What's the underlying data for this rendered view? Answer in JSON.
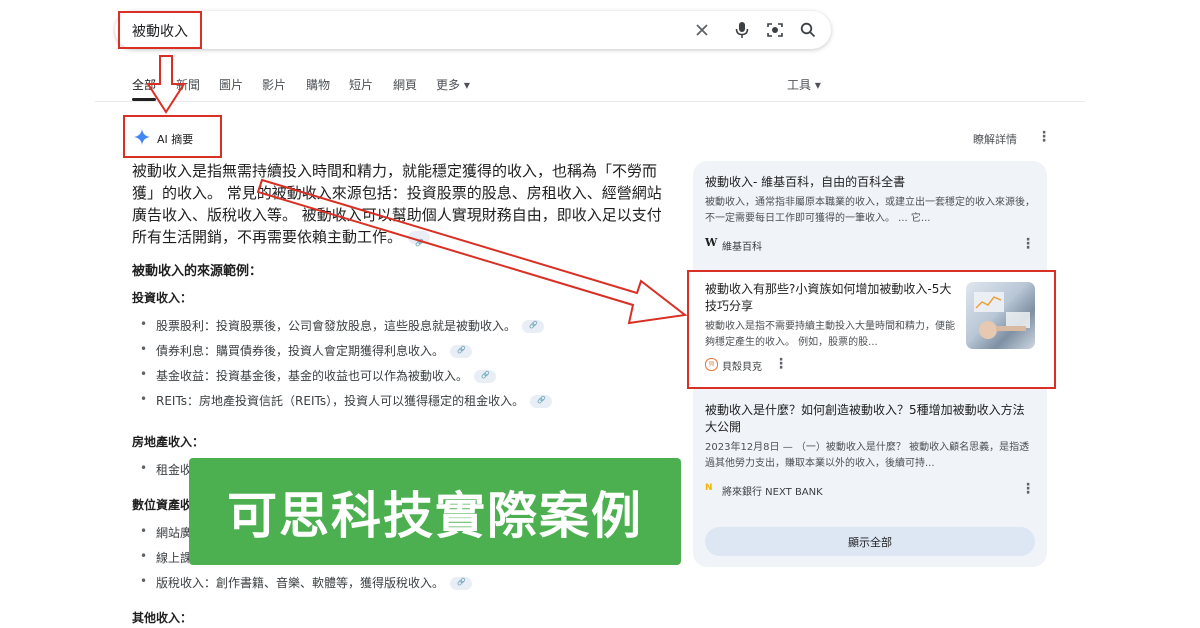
{
  "search": {
    "query": "被動收入"
  },
  "tabs": [
    {
      "label": "全部"
    },
    {
      "label": "新聞"
    },
    {
      "label": "圖片"
    },
    {
      "label": "影片"
    },
    {
      "label": "購物"
    },
    {
      "label": "短片"
    },
    {
      "label": "網頁"
    },
    {
      "label": "更多 ▾"
    }
  ],
  "tools_label": "工具 ▾",
  "ai_overview": {
    "label": "AI 摘要",
    "learn_more": "瞭解詳情",
    "paragraph": "被動收入是指無需持續投入時間和精力，就能穩定獲得的收入，也稱為「不勞而獲」的收入。 常見的被動收入來源包括：投資股票的股息、房租收入、經營網站廣告收入、版稅收入等。 被動收入可以幫助個人實現財務自由，即收入足以支付所有生活開銷，不再需要依賴主動工作。",
    "examples_heading": "被動收入的來源範例：",
    "investment_heading": "投資收入：",
    "investment_items": [
      "股票股利：投資股票後，公司會發放股息，這些股息就是被動收入。",
      "債券利息：購買債券後，投資人會定期獲得利息收入。",
      "基金收益：投資基金後，基金的收益也可以作為被動收入。",
      "REITs：房地產投資信託（REITs），投資人可以獲得穩定的租金收入。"
    ],
    "realestate_heading": "房地產收入：",
    "realestate_items": [
      "租金收"
    ],
    "digital_heading": "數位資產收",
    "digital_items": [
      "網站廣",
      "線上課",
      "版稅收入：創作書籍、音樂、軟體等，獲得版稅收入。"
    ],
    "other_heading": "其他收入："
  },
  "sources": [
    {
      "title": "被動收入- 維基百科，自由的百科全書",
      "snippet": "被動收入，通常指非屬原本職業的收入，或建立出一套穩定的收入來源後，不一定需要每日工作即可獲得的一筆收入。 ... 它...",
      "site": "維基百科",
      "site_icon": "W"
    },
    {
      "title": "被動收入有那些?小資族如何增加被動收入-5大技巧分享",
      "snippet": "被動收入是指不需要持續主動投入大量時間和精力，便能夠穩定產生的收入。 例如，股票的股...",
      "site": "貝殼貝克",
      "site_icon": "貝"
    },
    {
      "title": "被動收入是什麼？如何創造被動收入？5種增加被動收入方法大公開",
      "date": "2023年12月8日 —",
      "snippet": "（一）被動收入是什麼？ 被動收入顧名思義，是指透過其他勞力支出，賺取本業以外的收入，後續可持...",
      "site": "將來銀行 NEXT BANK",
      "site_icon": "N"
    }
  ],
  "show_all": "顯示全部",
  "banner": "可思科技實際案例",
  "colors": {
    "annotation_red": "#d93025",
    "banner_green": "#4caf50",
    "panel_bg": "#f0f4f9"
  }
}
